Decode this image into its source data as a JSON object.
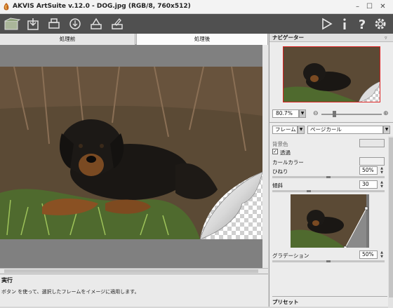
{
  "window": {
    "title": "AKVIS ArtSuite v.12.0 - DOG.jpg (RGB/8, 760x512)"
  },
  "toolbar": {
    "left_icons": [
      "open-icon",
      "save-icon",
      "print-icon",
      "share-icon",
      "batch-icon",
      "pen-icon"
    ],
    "right_icons": [
      "run-icon",
      "info-icon",
      "help-icon",
      "settings-icon"
    ]
  },
  "tabs": {
    "before": "処理前",
    "after": "処理後"
  },
  "navigator": {
    "title": "ナビゲーター",
    "zoom": "80.7%"
  },
  "settings": {
    "frame_label": "フレーム",
    "frame_value": "ページカール",
    "bg_color_label": "背景色",
    "transparent_label": "透過",
    "curl_color_label": "カールカラー",
    "twist_label": "ひねり",
    "twist_value": "50%",
    "slope_label": "傾斜",
    "slope_value": "30",
    "gradation_label": "グラデーション",
    "gradation_value": "50%",
    "preset_label": "プリセット"
  },
  "action": {
    "title": "実行",
    "description": "ボタン を使って、選択したフレームをイメージに適用します。"
  },
  "colors": {
    "toolbar": "#505050",
    "panel": "#ececec",
    "canvas_bg": "#808080"
  }
}
